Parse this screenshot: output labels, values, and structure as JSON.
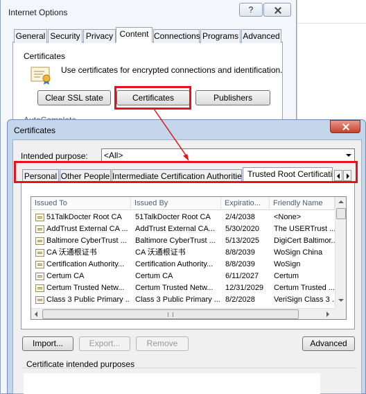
{
  "internet_options": {
    "title": "Internet Options",
    "help_label": "?",
    "tabs": [
      "General",
      "Security",
      "Privacy",
      "Content",
      "Connections",
      "Programs",
      "Advanced"
    ],
    "active_tab": "Content",
    "certificates_group": "Certificates",
    "certificates_description": "Use certificates for encrypted connections and identification.",
    "buttons": {
      "clear_ssl": "Clear SSL state",
      "certificates": "Certificates",
      "publishers": "Publishers"
    },
    "autocomplete_label": "AutoComplete"
  },
  "certificates_dialog": {
    "title": "Certificates",
    "intended_purpose_label": "Intended purpose:",
    "intended_purpose_value": "<All>",
    "tabs": [
      "Personal",
      "Other People",
      "Intermediate Certification Authorities",
      "Trusted Root Certification"
    ],
    "active_tab": "Trusted Root Certification",
    "columns": [
      "Issued To",
      "Issued By",
      "Expiratio...",
      "Friendly Name"
    ],
    "rows": [
      {
        "issued_to": "51TalkDocter Root CA",
        "issued_by": "51TalkDocter Root CA",
        "expiration": "2/4/2038",
        "friendly_name": "<None>"
      },
      {
        "issued_to": "AddTrust External CA ...",
        "issued_by": "AddTrust External CA...",
        "expiration": "5/30/2020",
        "friendly_name": "The USERTrust ..."
      },
      {
        "issued_to": "Baltimore CyberTrust ...",
        "issued_by": "Baltimore CyberTrust ...",
        "expiration": "5/13/2025",
        "friendly_name": "DigiCert Baltimor..."
      },
      {
        "issued_to": "CA 沃通根证书",
        "issued_by": "CA 沃通根证书",
        "expiration": "8/8/2039",
        "friendly_name": "WoSign China"
      },
      {
        "issued_to": "Certification Authority...",
        "issued_by": "Certification Authority...",
        "expiration": "8/8/2039",
        "friendly_name": "WoSign"
      },
      {
        "issued_to": "Certum CA",
        "issued_by": "Certum CA",
        "expiration": "6/11/2027",
        "friendly_name": "Certum"
      },
      {
        "issued_to": "Certum Trusted Netw...",
        "issued_by": "Certum Trusted Netw...",
        "expiration": "12/31/2029",
        "friendly_name": "Certum Trusted ..."
      },
      {
        "issued_to": "Class 3 Public Primary ...",
        "issued_by": "Class 3 Public Primary ...",
        "expiration": "8/2/2028",
        "friendly_name": "VeriSign Class 3 ..."
      }
    ],
    "buttons": {
      "import": "Import...",
      "export": "Export...",
      "remove": "Remove",
      "advanced": "Advanced"
    },
    "purposes_group_label": "Certificate intended purposes"
  },
  "colors": {
    "highlight": "#e8121c",
    "dialog_frame": "#c3d6ec",
    "close_button": "#c7402a"
  }
}
